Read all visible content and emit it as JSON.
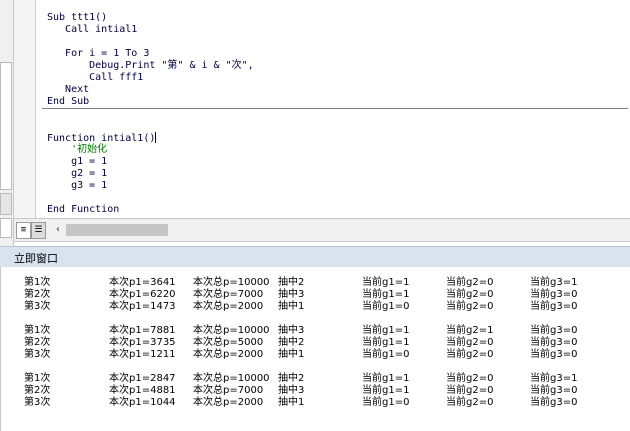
{
  "code": {
    "lines": [
      {
        "text": "Sub ttt1()",
        "kind": "code"
      },
      {
        "text": "   Call intial1",
        "kind": "code"
      },
      {
        "text": "   For i = 1 To 3",
        "kind": "code"
      },
      {
        "text": "       Debug.Print \"第\" & i & \"次\",",
        "kind": "code"
      },
      {
        "text": "       Call fff1",
        "kind": "code"
      },
      {
        "text": "   Next",
        "kind": "code"
      },
      {
        "text": "End Sub",
        "kind": "code"
      },
      {
        "text": "Function intial1()",
        "kind": "code"
      },
      {
        "text": "    '初始化",
        "kind": "comment"
      },
      {
        "text": "    g1 = 1",
        "kind": "code"
      },
      {
        "text": "    g2 = 1",
        "kind": "code"
      },
      {
        "text": "    g3 = 1",
        "kind": "code"
      },
      {
        "text": "End Function",
        "kind": "code"
      }
    ]
  },
  "immediate": {
    "title": "立即窗口",
    "rows": [
      [
        "第1次",
        "本次p1=3641",
        "本次总p=10000",
        "抽中2",
        "当前g1=1",
        "当前g2=0",
        "当前g3=1"
      ],
      [
        "第2次",
        "本次p1=6220",
        "本次总p=7000",
        "抽中3",
        "当前g1=1",
        "当前g2=0",
        "当前g3=0"
      ],
      [
        "第3次",
        "本次p1=1473",
        "本次总p=2000",
        "抽中1",
        "当前g1=0",
        "当前g2=0",
        "当前g3=0"
      ],
      [
        "第1次",
        "本次p1=7881",
        "本次总p=10000",
        "抽中3",
        "当前g1=1",
        "当前g2=1",
        "当前g3=0"
      ],
      [
        "第2次",
        "本次p1=3735",
        "本次总p=5000",
        "抽中2",
        "当前g1=1",
        "当前g2=0",
        "当前g3=0"
      ],
      [
        "第3次",
        "本次p1=1211",
        "本次总p=2000",
        "抽中1",
        "当前g1=0",
        "当前g2=0",
        "当前g3=0"
      ],
      [
        "第1次",
        "本次p1=2847",
        "本次总p=10000",
        "抽中2",
        "当前g1=1",
        "当前g2=0",
        "当前g3=1"
      ],
      [
        "第2次",
        "本次p1=4881",
        "本次总p=7000",
        "抽中3",
        "当前g1=1",
        "当前g2=0",
        "当前g3=0"
      ],
      [
        "第3次",
        "本次p1=1044",
        "本次总p=2000",
        "抽中1",
        "当前g1=0",
        "当前g2=0",
        "当前g3=0"
      ]
    ]
  },
  "icons": {
    "procedure_view": "procedure-view-icon",
    "module_view": "full-module-view-icon",
    "scroll_left": "chevron-left-icon"
  },
  "colors": {
    "code_text": "#000040",
    "comment": "#008000",
    "immediate_title_bg": "#d9e3ef"
  }
}
